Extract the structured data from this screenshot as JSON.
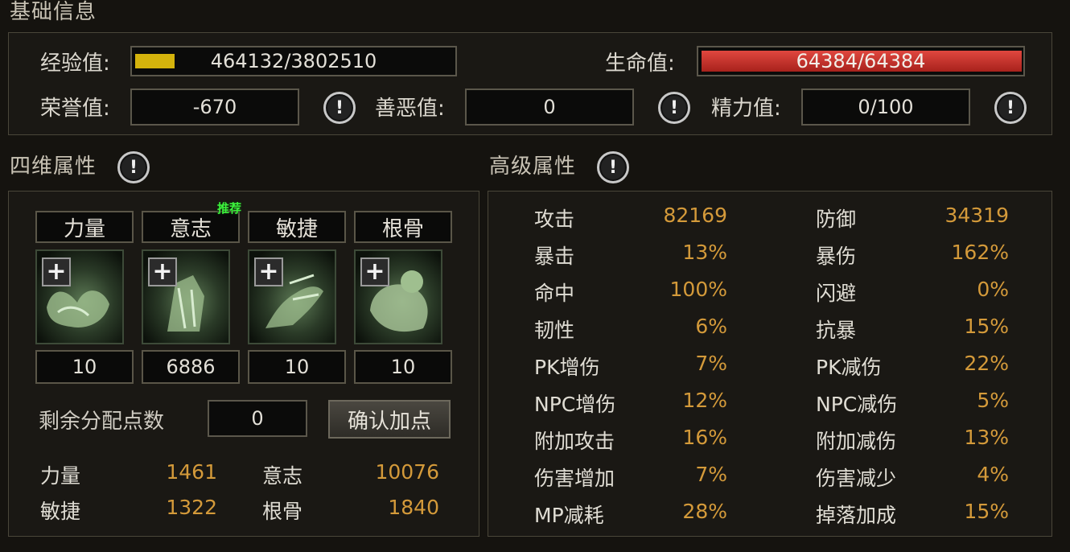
{
  "basic": {
    "title": "基础信息",
    "exp_label": "经验值:",
    "exp_value": "464132/3802510",
    "exp_fraction": 0.122,
    "hp_label": "生命值:",
    "hp_value": "64384/64384",
    "hp_fraction": 1.0,
    "honor_label": "荣誉值:",
    "honor_value": "-670",
    "karma_label": "善恶值:",
    "karma_value": "0",
    "energy_label": "精力值:",
    "energy_value": "0/100",
    "info_glyph": "!"
  },
  "four_dim": {
    "title": "四维属性",
    "recommend_badge": "推荐",
    "attrs": [
      {
        "name": "力量",
        "value": "10"
      },
      {
        "name": "意志",
        "value": "6886"
      },
      {
        "name": "敏捷",
        "value": "10"
      },
      {
        "name": "根骨",
        "value": "10"
      }
    ],
    "plus_glyph": "+",
    "remaining_label": "剩余分配点数",
    "remaining_value": "0",
    "confirm_label": "确认加点",
    "totals": [
      {
        "name": "力量",
        "value": "1461"
      },
      {
        "name": "意志",
        "value": "10076"
      },
      {
        "name": "敏捷",
        "value": "1322"
      },
      {
        "name": "根骨",
        "value": "1840"
      }
    ]
  },
  "advanced": {
    "title": "高级属性",
    "left": [
      {
        "name": "攻击",
        "value": "82169"
      },
      {
        "name": "暴击",
        "value": "13%"
      },
      {
        "name": "命中",
        "value": "100%"
      },
      {
        "name": "韧性",
        "value": "6%"
      },
      {
        "name": "PK增伤",
        "value": "7%"
      },
      {
        "name": "NPC增伤",
        "value": "12%"
      },
      {
        "name": "附加攻击",
        "value": "16%"
      },
      {
        "name": "伤害增加",
        "value": "7%"
      },
      {
        "name": "MP减耗",
        "value": "28%"
      }
    ],
    "right": [
      {
        "name": "防御",
        "value": "34319"
      },
      {
        "name": "暴伤",
        "value": "162%"
      },
      {
        "name": "闪避",
        "value": "0%"
      },
      {
        "name": "抗暴",
        "value": "15%"
      },
      {
        "name": "PK减伤",
        "value": "22%"
      },
      {
        "name": "NPC减伤",
        "value": "5%"
      },
      {
        "name": "附加减伤",
        "value": "13%"
      },
      {
        "name": "伤害减少",
        "value": "4%"
      },
      {
        "name": "掉落加成",
        "value": "15%"
      }
    ]
  },
  "colors": {
    "exp_bar": "#d4b30c",
    "hp_bar": "#c8302a",
    "value_gold": "#d49a3a",
    "recommend_green": "#3cf03c"
  }
}
